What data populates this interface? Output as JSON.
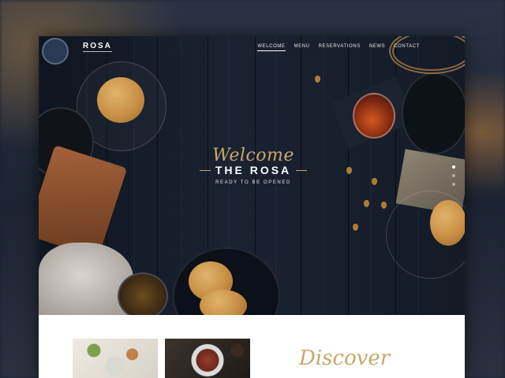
{
  "site": {
    "logo": "ROSA"
  },
  "nav": {
    "items": [
      {
        "label": "WELCOME",
        "active": true
      },
      {
        "label": "MENU",
        "active": false
      },
      {
        "label": "RESERVATIONS",
        "active": false
      },
      {
        "label": "NEWS",
        "active": false
      },
      {
        "label": "CONTACT",
        "active": false
      }
    ]
  },
  "hero": {
    "script_heading": "Welcome",
    "title": "THE ROSA",
    "subtitle": "READY TO BE OPENED",
    "slides": {
      "count": 3,
      "active_index": 0
    }
  },
  "section": {
    "script_heading": "Discover"
  },
  "colors": {
    "accent_gold": "#c9a76a",
    "hero_background": "#141b27",
    "text_light": "#ffffff"
  },
  "icons": [
    "slide-dot-icon"
  ]
}
